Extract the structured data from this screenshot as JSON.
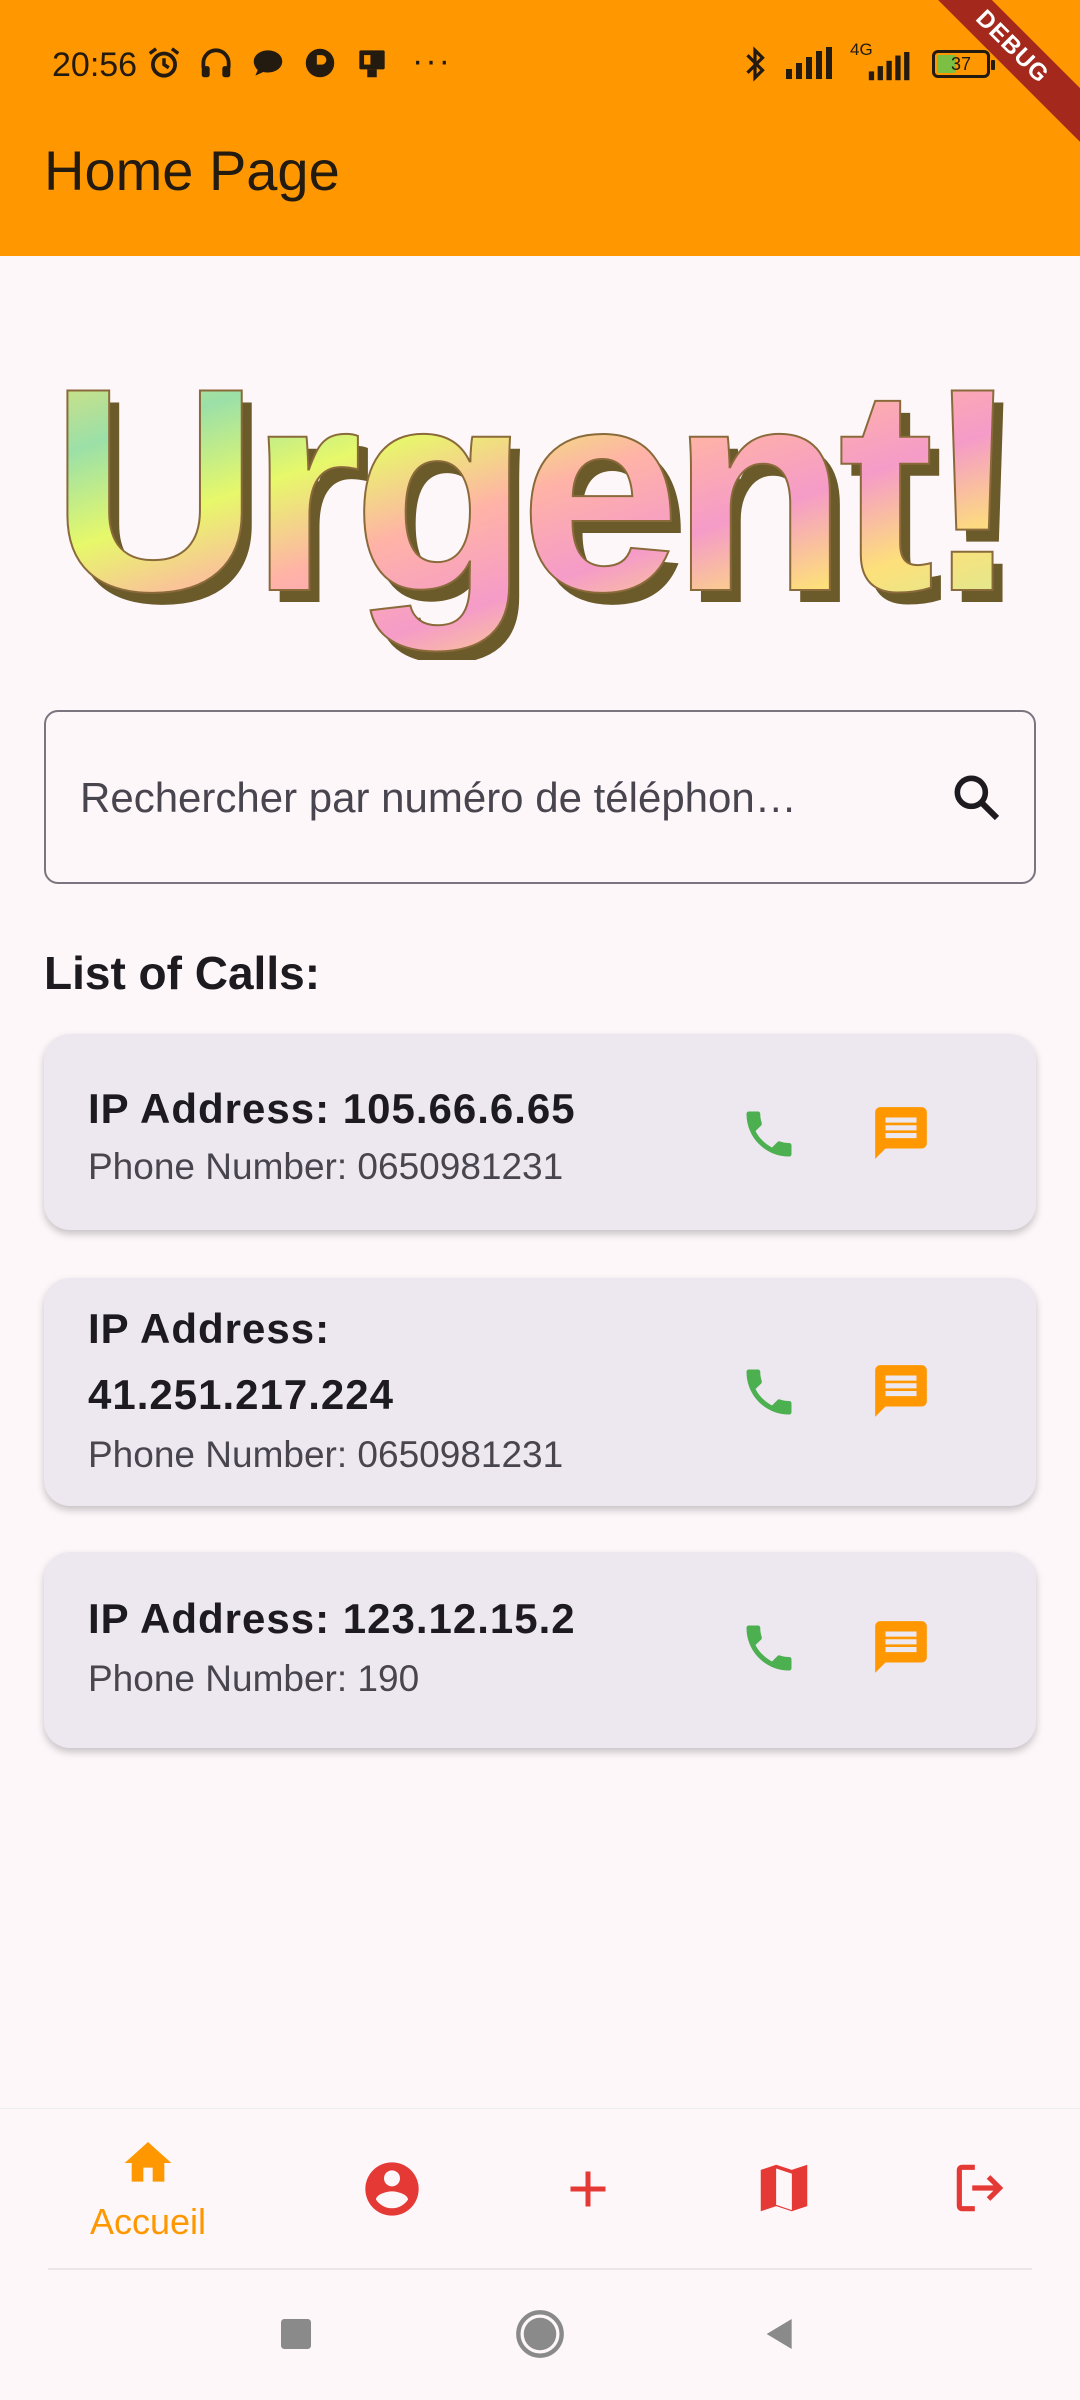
{
  "status_bar": {
    "time": "20:56",
    "more": "···",
    "network_label": "4G",
    "battery_level": "37"
  },
  "debug_banner": "DEBUG",
  "app_bar": {
    "title": "Home Page"
  },
  "logo_text": "Urgent!",
  "search": {
    "placeholder": "Rechercher par numéro de téléphon…",
    "value": ""
  },
  "list_title": "List of Calls:",
  "calls": [
    {
      "ip_line1": "IP Address: 105.66.6.65",
      "ip_line2": "",
      "phone": "Phone Number: 0650981231"
    },
    {
      "ip_line1": "IP Address:",
      "ip_line2": "41.251.217.224",
      "phone": "Phone Number: 0650981231"
    },
    {
      "ip_line1": "IP Address: 123.12.15.2",
      "ip_line2": "",
      "phone": "Phone Number: 190"
    }
  ],
  "bottom_nav": {
    "items": [
      {
        "icon": "home-icon",
        "label": "Accueil",
        "active": true
      },
      {
        "icon": "account-circle-icon",
        "label": ""
      },
      {
        "icon": "add-icon",
        "label": ""
      },
      {
        "icon": "map-icon",
        "label": ""
      },
      {
        "icon": "logout-icon",
        "label": ""
      }
    ]
  },
  "colors": {
    "primary": "#ff9800",
    "call_icon": "#4caf50",
    "nav_icon": "#e53935",
    "card_bg": "#ede8ef"
  }
}
